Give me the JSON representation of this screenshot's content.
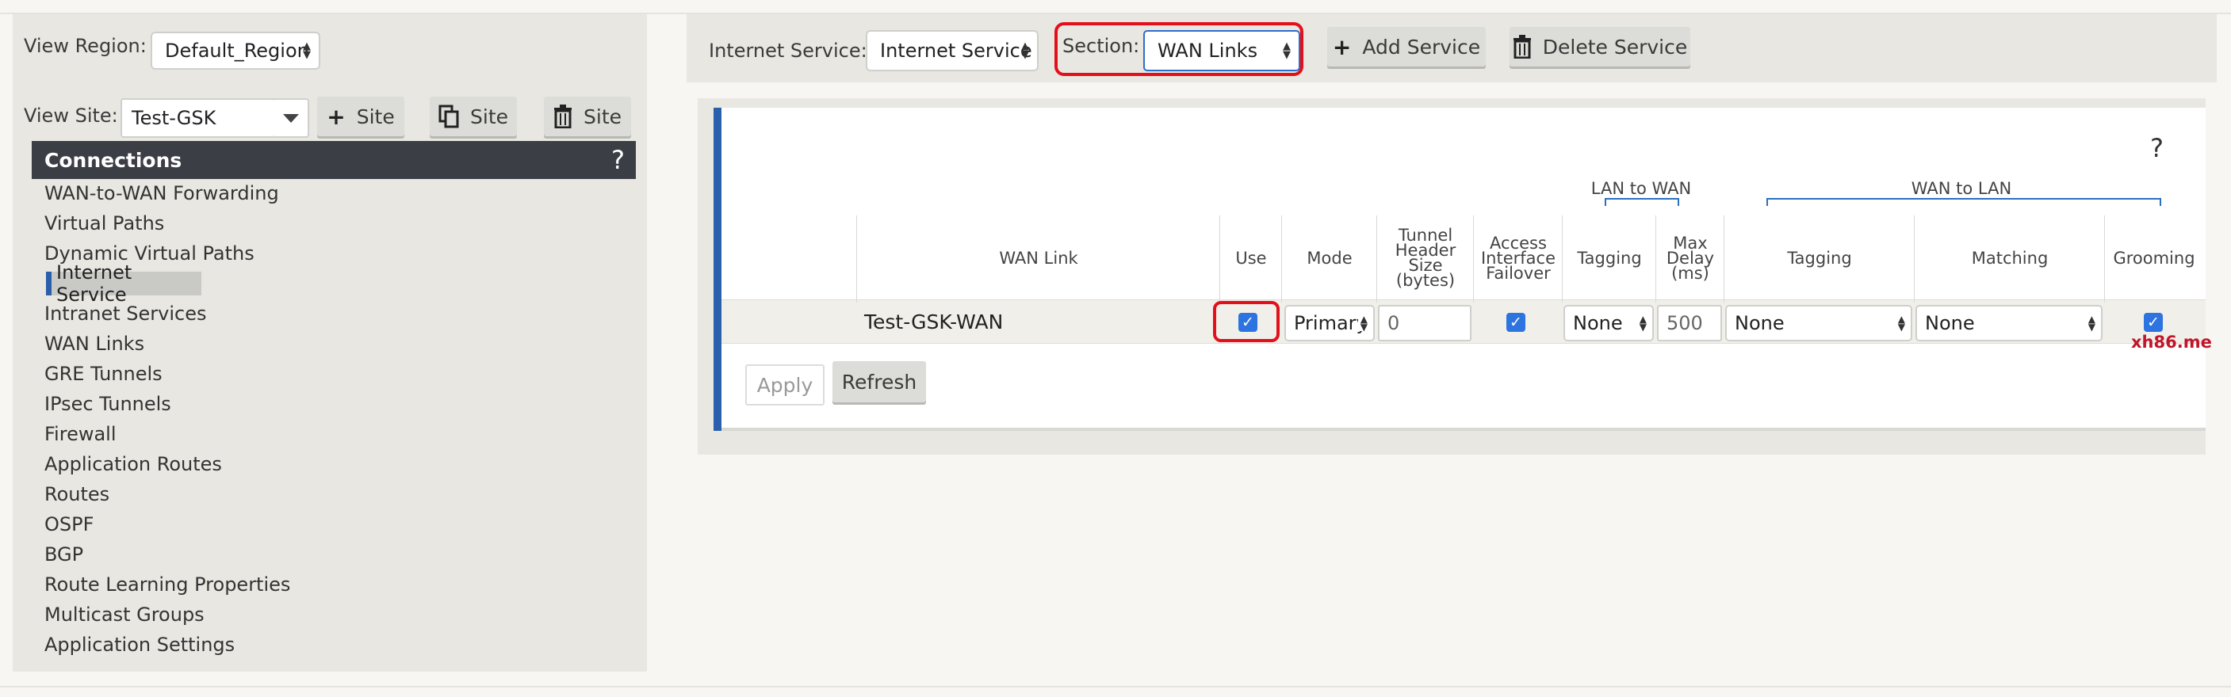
{
  "view_region": {
    "label": "View Region:",
    "value": "Default_Region"
  },
  "view_site": {
    "label": "View Site:",
    "value": "Test-GSK",
    "add_label": "Site",
    "clone_label": "Site",
    "delete_label": "Site"
  },
  "connections": {
    "title": "Connections",
    "help": "?",
    "items": [
      "WAN-to-WAN Forwarding",
      "Virtual Paths",
      "Dynamic Virtual Paths",
      "Internet Service",
      "Intranet Services",
      "WAN Links",
      "GRE Tunnels",
      "IPsec Tunnels",
      "Firewall",
      "Application Routes",
      "Routes",
      "OSPF",
      "BGP",
      "Route Learning Properties",
      "Multicast Groups",
      "Application Settings"
    ],
    "selected": "Internet Service"
  },
  "toolbar": {
    "service_label": "Internet Service:",
    "service_value": "Internet Service",
    "section_label": "Section:",
    "section_value": "WAN Links",
    "add_service": "Add Service",
    "delete_service": "Delete Service"
  },
  "table": {
    "help": "?",
    "group_lan_to_wan": "LAN to WAN",
    "group_wan_to_lan": "WAN to LAN",
    "headers": {
      "wan_link": "WAN Link",
      "use": "Use",
      "mode": "Mode",
      "tunnel_header": [
        "Tunnel",
        "Header",
        "Size",
        "(bytes)"
      ],
      "access_failover": [
        "Access",
        "Interface",
        "Failover"
      ],
      "tagging_l2w": "Tagging",
      "max_delay": [
        "Max",
        "Delay",
        "(ms)"
      ],
      "tagging_w2l": "Tagging",
      "matching": "Matching",
      "grooming": "Grooming"
    },
    "row": {
      "wan_link": "Test-GSK-WAN",
      "use": true,
      "mode": "Primary",
      "tunnel_header": "0",
      "access_failover": true,
      "tagging_l2w": "None",
      "max_delay": "500",
      "tagging_w2l": "None",
      "matching": "None",
      "grooming": true
    },
    "apply": "Apply",
    "refresh": "Refresh"
  },
  "watermark": "xh86.me",
  "colors": {
    "accent": "#2a5fab",
    "highlight": "#e3101b",
    "header_bg": "#3b3e45",
    "checkbox": "#2d74e0"
  },
  "icons": {
    "add": "plus-icon",
    "clone": "copy-icon",
    "delete": "trash-icon"
  }
}
